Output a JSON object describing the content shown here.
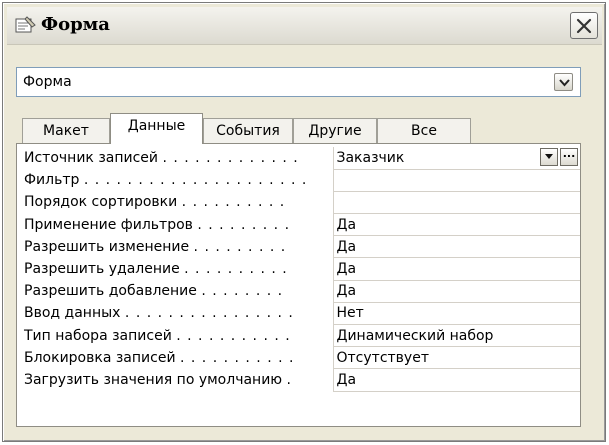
{
  "window": {
    "title": "Форма",
    "object_select": {
      "value": "Форма"
    }
  },
  "tabs": [
    {
      "label": "Макет",
      "active": false
    },
    {
      "label": "Данные",
      "active": true
    },
    {
      "label": "События",
      "active": false
    },
    {
      "label": "Другие",
      "active": false
    },
    {
      "label": "Все",
      "active": false
    }
  ],
  "properties": [
    {
      "label": "Источник записей",
      "dots": ". . . . . . . . . . . . .",
      "value": "Заказчик"
    },
    {
      "label": "Фильтр",
      "dots": ". . . . . . . . . . . . . . . . . . . . .",
      "value": ""
    },
    {
      "label": "Порядок сортировки",
      "dots": ". . . . . . . . . .",
      "value": ""
    },
    {
      "label": "Применение фильтров",
      "dots": ". . . . . . . . .",
      "value": "Да"
    },
    {
      "label": "Разрешить изменение",
      "dots": ". . . . . . . . .",
      "value": "Да"
    },
    {
      "label": "Разрешить удаление",
      "dots": ". . . . . . . . . .",
      "value": "Да"
    },
    {
      "label": "Разрешить добавление",
      "dots": ". . . . . . . .",
      "value": "Да"
    },
    {
      "label": "Ввод данных",
      "dots": ". . . . . . . . . . . . . . . .",
      "value": "Нет"
    },
    {
      "label": "Тип набора записей",
      "dots": ". . . . . . . . . . .",
      "value": "Динамический набор"
    },
    {
      "label": "Блокировка записей",
      "dots": ". . . . . . . . . . .",
      "value": "Отсутствует"
    },
    {
      "label": "Загрузить значения по умолчанию",
      "dots": ".",
      "value": "Да"
    }
  ],
  "icons": {
    "title": "properties-icon",
    "close": "close-icon",
    "dropdown": "chevron-down-icon",
    "build": "ellipsis-icon"
  },
  "build_button_label": "..."
}
